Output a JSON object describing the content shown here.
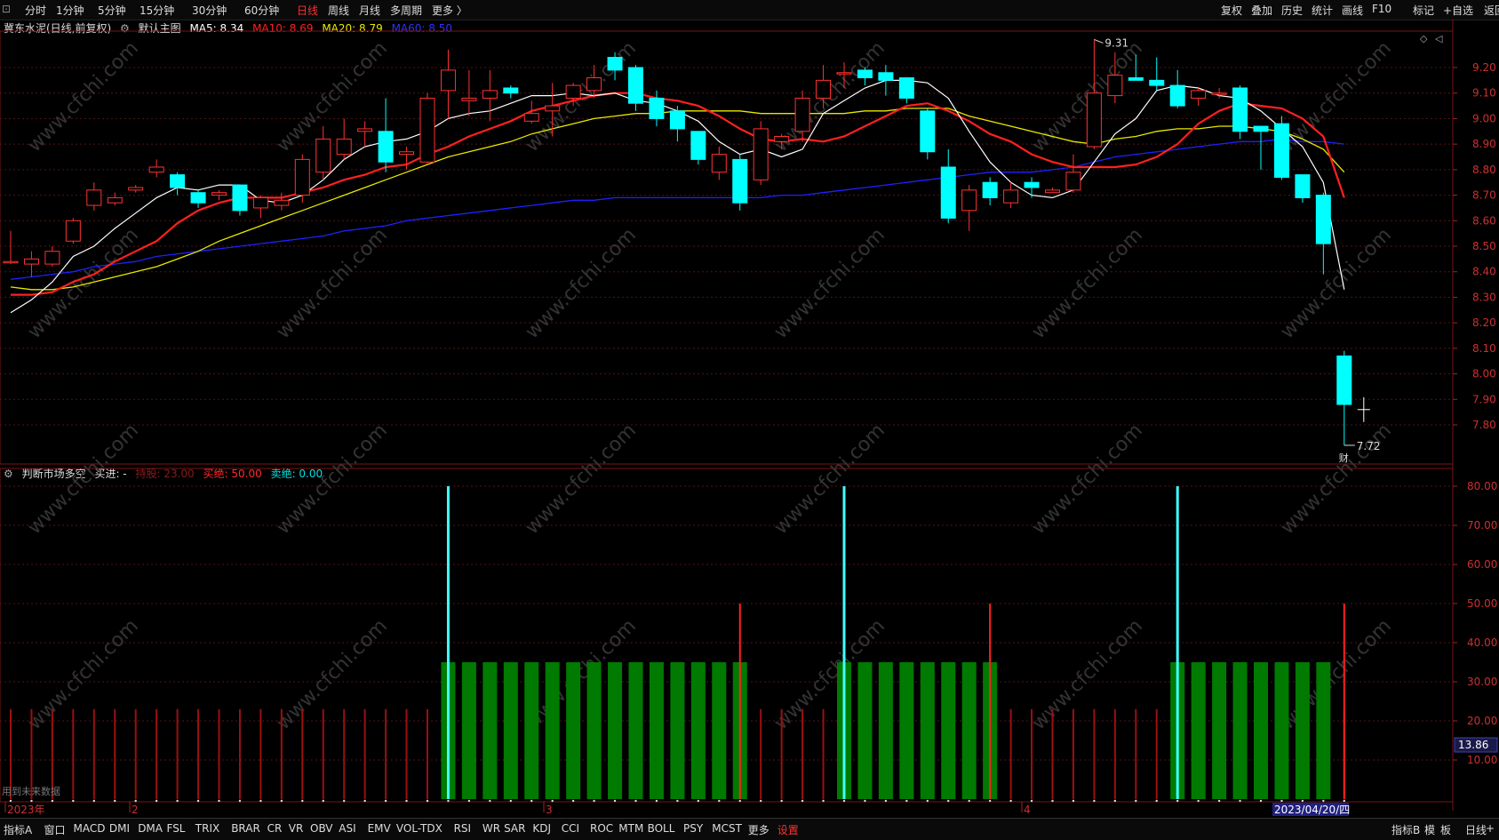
{
  "topbar": {
    "period_tabs": [
      "分时",
      "1分钟",
      "5分钟",
      "15分钟",
      "30分钟",
      "60分钟",
      "日线",
      "周线",
      "月线",
      "多周期",
      "更多 〉"
    ],
    "active_tab": "日线",
    "right_buttons": [
      "复权",
      "叠加",
      "历史",
      "统计",
      "画线",
      "F10",
      "标记",
      "+自选",
      "返回"
    ]
  },
  "main_chart": {
    "stock_title": "冀东水泥(日线,前复权)",
    "template_label": "默认主图",
    "ma5_label": "MA5: 8.34",
    "ma10_label": "MA10: 8.69",
    "ma20_label": "MA20: 8.79",
    "ma60_label": "MA60: 8.50",
    "high_marker": "9.31",
    "low_marker": "7.72",
    "event_marker": "财",
    "hint_text": "用到未来数据"
  },
  "indicator": {
    "name": "判断市场多空",
    "buy_label": "买进: -",
    "hold_label": "持股: 23.00",
    "buy_signal_label": "买绝: 50.00",
    "sell_signal_label": "卖绝: 0.00",
    "current_value": "13.86"
  },
  "x_axis": {
    "labels": [
      "2023年",
      "2",
      "3",
      "4"
    ],
    "cursor_date": "2023/04/20/四"
  },
  "bottombar": {
    "left_items": [
      "指标A",
      "窗口",
      "MACD",
      "DMI",
      "DMA",
      "FSL",
      "TRIX",
      "BRAR",
      "CR",
      "VR",
      "OBV",
      "ASI",
      "EMV",
      "VOL-TDX",
      "RSI",
      "WR",
      "SAR",
      "KDJ",
      "CCI",
      "ROC",
      "MTM",
      "BOLL",
      "PSY",
      "MCST",
      "更多",
      "设置"
    ],
    "active_item": "设置",
    "right_items": [
      "指标B",
      "模",
      "板",
      "日线",
      "+",
      "−"
    ]
  },
  "watermark": "www.cfchi.com",
  "colors": {
    "up": "#ff3232",
    "down": "#00ffff",
    "ma5": "#ffffff",
    "ma10": "#ff2020",
    "ma20": "#e8e800",
    "ma60": "#2020ff",
    "hold_bar": "#007a00",
    "grid": "#551515"
  },
  "chart_data": [
    {
      "type": "candlestick",
      "title": "冀东水泥(日线,前复权)",
      "y_ticks": [
        "9.20",
        "9.10",
        "9.00",
        "8.90",
        "8.80",
        "8.70",
        "8.60",
        "8.50",
        "8.40",
        "8.30",
        "8.20",
        "8.10",
        "8.00",
        "7.90",
        "7.80"
      ],
      "ylim": [
        7.7,
        9.3
      ],
      "candles": [
        [
          8.44,
          8.44,
          8.43,
          8.56
        ],
        [
          8.43,
          8.45,
          8.38,
          8.48
        ],
        [
          8.43,
          8.48,
          8.42,
          8.5
        ],
        [
          8.52,
          8.6,
          8.51,
          8.61
        ],
        [
          8.66,
          8.72,
          8.64,
          8.75
        ],
        [
          8.67,
          8.69,
          8.66,
          8.71
        ],
        [
          8.72,
          8.73,
          8.71,
          8.74
        ],
        [
          8.79,
          8.81,
          8.77,
          8.84
        ],
        [
          8.78,
          8.73,
          8.7,
          8.79
        ],
        [
          8.71,
          8.67,
          8.65,
          8.72
        ],
        [
          8.7,
          8.71,
          8.68,
          8.72
        ],
        [
          8.74,
          8.64,
          8.62,
          8.74
        ],
        [
          8.65,
          8.69,
          8.61,
          8.7
        ],
        [
          8.66,
          8.68,
          8.64,
          8.71
        ],
        [
          8.7,
          8.84,
          8.67,
          8.86
        ],
        [
          8.79,
          8.92,
          8.76,
          8.97
        ],
        [
          8.86,
          8.92,
          8.84,
          9.0
        ],
        [
          8.95,
          8.96,
          8.89,
          8.99
        ],
        [
          8.95,
          8.83,
          8.79,
          9.08
        ],
        [
          8.86,
          8.87,
          8.8,
          8.89
        ],
        [
          8.83,
          9.08,
          8.82,
          9.1
        ],
        [
          9.11,
          9.19,
          9.0,
          9.27
        ],
        [
          9.07,
          9.08,
          9.01,
          9.19
        ],
        [
          9.08,
          9.11,
          8.99,
          9.19
        ],
        [
          9.12,
          9.1,
          9.08,
          9.13
        ],
        [
          8.99,
          9.02,
          8.98,
          9.07
        ],
        [
          9.03,
          9.05,
          8.93,
          9.14
        ],
        [
          9.08,
          9.13,
          9.05,
          9.14
        ],
        [
          9.11,
          9.16,
          9.08,
          9.21
        ],
        [
          9.24,
          9.19,
          9.15,
          9.26
        ],
        [
          9.2,
          9.06,
          9.03,
          9.21
        ],
        [
          9.08,
          9.0,
          8.97,
          9.11
        ],
        [
          9.03,
          8.96,
          8.91,
          9.05
        ],
        [
          8.95,
          8.84,
          8.82,
          8.95
        ],
        [
          8.79,
          8.86,
          8.76,
          8.89
        ],
        [
          8.84,
          8.67,
          8.64,
          8.86
        ],
        [
          8.76,
          8.96,
          8.74,
          8.99
        ],
        [
          8.91,
          8.93,
          8.88,
          8.94
        ],
        [
          8.95,
          9.08,
          8.91,
          9.11
        ],
        [
          9.08,
          9.15,
          9.04,
          9.21
        ],
        [
          9.18,
          9.18,
          9.12,
          9.22
        ],
        [
          9.19,
          9.16,
          9.13,
          9.2
        ],
        [
          9.18,
          9.15,
          9.09,
          9.21
        ],
        [
          9.16,
          9.08,
          9.06,
          9.16
        ],
        [
          9.03,
          8.87,
          8.84,
          9.04
        ],
        [
          8.81,
          8.61,
          8.59,
          8.88
        ],
        [
          8.64,
          8.72,
          8.56,
          8.74
        ],
        [
          8.75,
          8.69,
          8.66,
          8.77
        ],
        [
          8.67,
          8.72,
          8.65,
          8.75
        ],
        [
          8.75,
          8.73,
          8.69,
          8.77
        ],
        [
          8.71,
          8.72,
          8.71,
          8.73
        ],
        [
          8.72,
          8.79,
          8.71,
          8.86
        ],
        [
          8.89,
          9.1,
          8.88,
          9.31
        ],
        [
          9.09,
          9.17,
          9.06,
          9.26
        ],
        [
          9.16,
          9.15,
          9.15,
          9.25
        ],
        [
          9.15,
          9.13,
          9.11,
          9.24
        ],
        [
          9.13,
          9.05,
          9.04,
          9.19
        ],
        [
          9.08,
          9.11,
          9.05,
          9.12
        ],
        [
          9.1,
          9.1,
          9.08,
          9.12
        ],
        [
          9.12,
          8.95,
          8.92,
          9.13
        ],
        [
          8.97,
          8.95,
          8.8,
          8.97
        ],
        [
          8.98,
          8.77,
          8.76,
          9.01
        ],
        [
          8.78,
          8.69,
          8.67,
          8.78
        ],
        [
          8.7,
          8.51,
          8.39,
          8.71
        ],
        [
          8.07,
          7.88,
          7.72,
          8.09
        ]
      ],
      "ma5": [
        8.24,
        8.29,
        8.36,
        8.46,
        8.5,
        8.57,
        8.63,
        8.69,
        8.73,
        8.72,
        8.74,
        8.74,
        8.68,
        8.67,
        8.7,
        8.76,
        8.84,
        8.89,
        8.91,
        8.92,
        8.95,
        9.0,
        9.02,
        9.03,
        9.06,
        9.09,
        9.09,
        9.1,
        9.09,
        9.1,
        9.07,
        9.06,
        9.03,
        8.99,
        8.91,
        8.86,
        8.88,
        8.85,
        8.88,
        9.02,
        9.07,
        9.12,
        9.15,
        9.15,
        9.14,
        9.08,
        8.95,
        8.83,
        8.75,
        8.7,
        8.69,
        8.72,
        8.83,
        8.94,
        9.0,
        9.11,
        9.13,
        9.12,
        9.09,
        9.08,
        9.03,
        8.96,
        8.89,
        8.75,
        8.33
      ],
      "ma10": [
        8.31,
        8.31,
        8.32,
        8.36,
        8.39,
        8.44,
        8.48,
        8.52,
        8.59,
        8.64,
        8.67,
        8.69,
        8.69,
        8.69,
        8.71,
        8.73,
        8.76,
        8.78,
        8.81,
        8.82,
        8.86,
        8.89,
        8.93,
        8.96,
        8.99,
        9.03,
        9.05,
        9.07,
        9.09,
        9.1,
        9.1,
        9.08,
        9.07,
        9.05,
        9.01,
        8.96,
        8.92,
        8.91,
        8.92,
        8.91,
        8.93,
        8.97,
        9.01,
        9.05,
        9.06,
        9.03,
        8.99,
        8.94,
        8.91,
        8.86,
        8.83,
        8.81,
        8.81,
        8.81,
        8.82,
        8.85,
        8.9,
        8.98,
        9.03,
        9.06,
        9.05,
        9.04,
        9.0,
        8.93,
        8.69
      ],
      "ma20": [
        8.34,
        8.33,
        8.33,
        8.34,
        8.36,
        8.38,
        8.4,
        8.42,
        8.45,
        8.48,
        8.52,
        8.55,
        8.58,
        8.61,
        8.64,
        8.67,
        8.7,
        8.73,
        8.76,
        8.79,
        8.82,
        8.85,
        8.87,
        8.89,
        8.91,
        8.94,
        8.96,
        8.98,
        9.0,
        9.01,
        9.02,
        9.02,
        9.03,
        9.03,
        9.03,
        9.03,
        9.02,
        9.02,
        9.02,
        9.02,
        9.02,
        9.03,
        9.03,
        9.04,
        9.04,
        9.04,
        9.01,
        8.99,
        8.97,
        8.95,
        8.93,
        8.91,
        8.9,
        8.92,
        8.93,
        8.95,
        8.96,
        8.96,
        8.97,
        8.97,
        8.96,
        8.95,
        8.92,
        8.88,
        8.79
      ],
      "ma60": [
        8.37,
        8.38,
        8.39,
        8.4,
        8.42,
        8.43,
        8.44,
        8.46,
        8.47,
        8.48,
        8.49,
        8.5,
        8.51,
        8.52,
        8.53,
        8.54,
        8.56,
        8.57,
        8.58,
        8.6,
        8.61,
        8.62,
        8.63,
        8.64,
        8.65,
        8.66,
        8.67,
        8.68,
        8.68,
        8.69,
        8.69,
        8.69,
        8.69,
        8.69,
        8.69,
        8.69,
        8.69,
        8.7,
        8.7,
        8.71,
        8.72,
        8.73,
        8.74,
        8.75,
        8.76,
        8.77,
        8.78,
        8.79,
        8.79,
        8.79,
        8.8,
        8.81,
        8.83,
        8.85,
        8.86,
        8.87,
        8.88,
        8.89,
        8.9,
        8.91,
        8.91,
        8.92,
        8.91,
        8.91,
        8.9
      ]
    },
    {
      "type": "bar",
      "title": "判断市场多空",
      "y_ticks": [
        "80.00",
        "70.00",
        "60.00",
        "50.00",
        "40.00",
        "30.00",
        "20.00",
        "10.00"
      ],
      "ylim": [
        0,
        80
      ],
      "series": [
        {
          "name": "持股",
          "values": [
            23,
            23,
            23,
            23,
            23,
            23,
            23,
            23,
            23,
            23,
            23,
            23,
            23,
            23,
            23,
            23,
            23,
            23,
            23,
            23,
            23,
            35,
            35,
            35,
            35,
            35,
            35,
            35,
            35,
            35,
            35,
            35,
            35,
            35,
            35,
            35,
            23,
            23,
            23,
            23,
            35,
            35,
            35,
            35,
            35,
            35,
            35,
            35,
            23,
            23,
            23,
            23,
            23,
            23,
            23,
            23,
            35,
            35,
            35,
            35,
            35,
            35,
            35,
            35,
            23
          ]
        },
        {
          "name": "买进",
          "values": [
            0,
            0,
            0,
            0,
            0,
            0,
            0,
            0,
            0,
            0,
            0,
            0,
            0,
            0,
            0,
            0,
            0,
            0,
            0,
            0,
            0,
            80,
            0,
            0,
            0,
            0,
            0,
            0,
            0,
            0,
            0,
            0,
            0,
            0,
            0,
            0,
            0,
            0,
            0,
            0,
            80,
            0,
            0,
            0,
            0,
            0,
            0,
            0,
            0,
            0,
            0,
            0,
            0,
            0,
            0,
            0,
            80,
            0,
            0,
            0,
            0,
            0,
            0,
            0,
            0
          ]
        },
        {
          "name": "买绝",
          "values": [
            0,
            0,
            0,
            0,
            0,
            0,
            0,
            0,
            0,
            0,
            0,
            0,
            0,
            0,
            0,
            0,
            0,
            0,
            0,
            0,
            0,
            0,
            0,
            0,
            0,
            0,
            0,
            0,
            0,
            0,
            0,
            0,
            0,
            0,
            0,
            50,
            0,
            0,
            0,
            0,
            0,
            0,
            0,
            0,
            0,
            0,
            0,
            50,
            0,
            0,
            0,
            0,
            0,
            0,
            0,
            0,
            0,
            0,
            0,
            0,
            0,
            0,
            0,
            0,
            50
          ]
        }
      ]
    }
  ]
}
